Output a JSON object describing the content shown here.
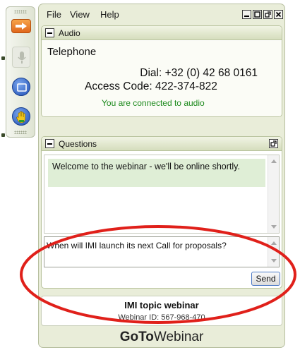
{
  "menu": {
    "file": "File",
    "view": "View",
    "help": "Help"
  },
  "audio": {
    "title": "Audio",
    "mode": "Telephone",
    "dial": "Dial: +32 (0) 42 68 0161",
    "access_code": "Access Code: 422-374-822",
    "status": "You are connected to audio",
    "status_color": "#1d8a1d"
  },
  "questions": {
    "title": "Questions",
    "log_message": "Welcome to the webinar - we'll be online shortly.",
    "input_value": "When will IMI launch its next Call for proposals?",
    "send_label": "Send"
  },
  "webinar": {
    "title": "IMI topic webinar",
    "id_text": "Webinar ID: 567-968-470"
  },
  "brand": {
    "goto": "GoTo",
    "rest": "Webinar"
  },
  "colors": {
    "annotation": "#e0201a",
    "panel": "#e9edd9",
    "accent_orange": "#e0661b"
  },
  "icons": {
    "toolbar_arrow": "arrow-right-icon",
    "toolbar_mic": "microphone-icon",
    "toolbar_screen": "screen-icon",
    "toolbar_hand": "raise-hand-icon"
  }
}
